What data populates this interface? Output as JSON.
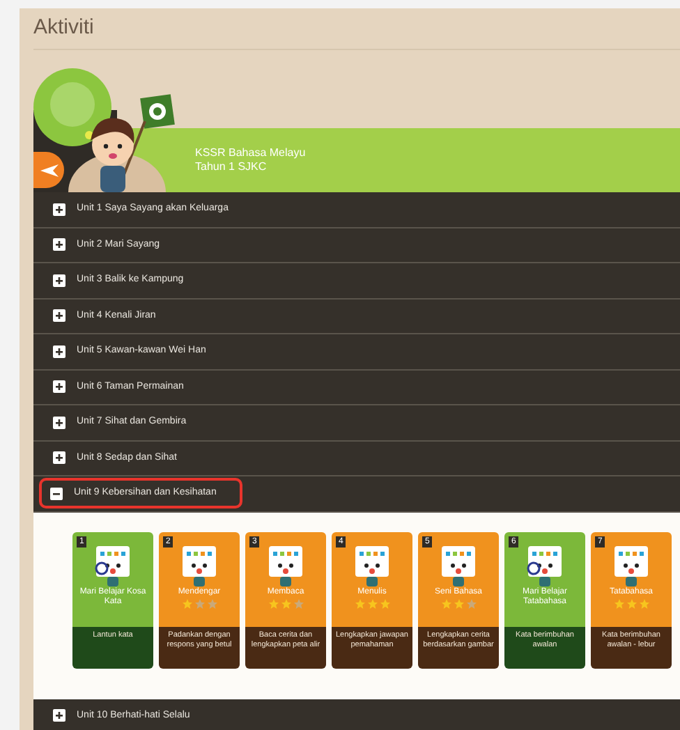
{
  "page_title": "Aktiviti",
  "course": {
    "title": "KSSR Bahasa Melayu",
    "subtitle": "Tahun 1 SJKC"
  },
  "units": [
    {
      "label": "Unit 1 Saya Sayang akan Keluarga",
      "expanded": false,
      "highlighted": false
    },
    {
      "label": "Unit 2 Mari Sayang",
      "expanded": false,
      "highlighted": false
    },
    {
      "label": "Unit 3 Balik ke Kampung",
      "expanded": false,
      "highlighted": false
    },
    {
      "label": "Unit 4 Kenali Jiran",
      "expanded": false,
      "highlighted": false
    },
    {
      "label": "Unit 5 Kawan-kawan Wei Han",
      "expanded": false,
      "highlighted": false
    },
    {
      "label": "Unit 6 Taman Permainan",
      "expanded": false,
      "highlighted": false
    },
    {
      "label": "Unit 7 Sihat dan Gembira",
      "expanded": false,
      "highlighted": false
    },
    {
      "label": "Unit 8 Sedap dan Sihat",
      "expanded": false,
      "highlighted": false
    },
    {
      "label": "Unit 9 Kebersihan dan Kesihatan",
      "expanded": true,
      "highlighted": true,
      "activities": [
        {
          "kind": "learn",
          "number": "1",
          "title": "Mari Belajar Kosa Kata",
          "description": "Lantun kata"
        },
        {
          "kind": "practice",
          "number": "2",
          "title": "Mendengar",
          "stars": 1,
          "description": "Padankan dengan respons yang betul"
        },
        {
          "kind": "practice",
          "number": "3",
          "title": "Membaca",
          "stars": 2,
          "description": "Baca cerita dan lengkapkan peta alir"
        },
        {
          "kind": "practice",
          "number": "4",
          "title": "Menulis",
          "stars": 3,
          "description": "Lengkapkan jawapan pemahaman"
        },
        {
          "kind": "practice",
          "number": "5",
          "title": "Seni Bahasa",
          "stars": 2,
          "description": "Lengkapkan cerita berdasarkan gambar"
        },
        {
          "kind": "learn",
          "number": "6",
          "title": "Mari Belajar Tatabahasa",
          "description": "Kata berimbuhan awalan"
        },
        {
          "kind": "practice",
          "number": "7",
          "title": "Tatabahasa",
          "stars": 3,
          "description": "Kata berimbuhan awalan - lebur"
        }
      ]
    },
    {
      "label": "Unit 10 Berhati-hati Selalu",
      "expanded": false,
      "highlighted": false
    }
  ]
}
